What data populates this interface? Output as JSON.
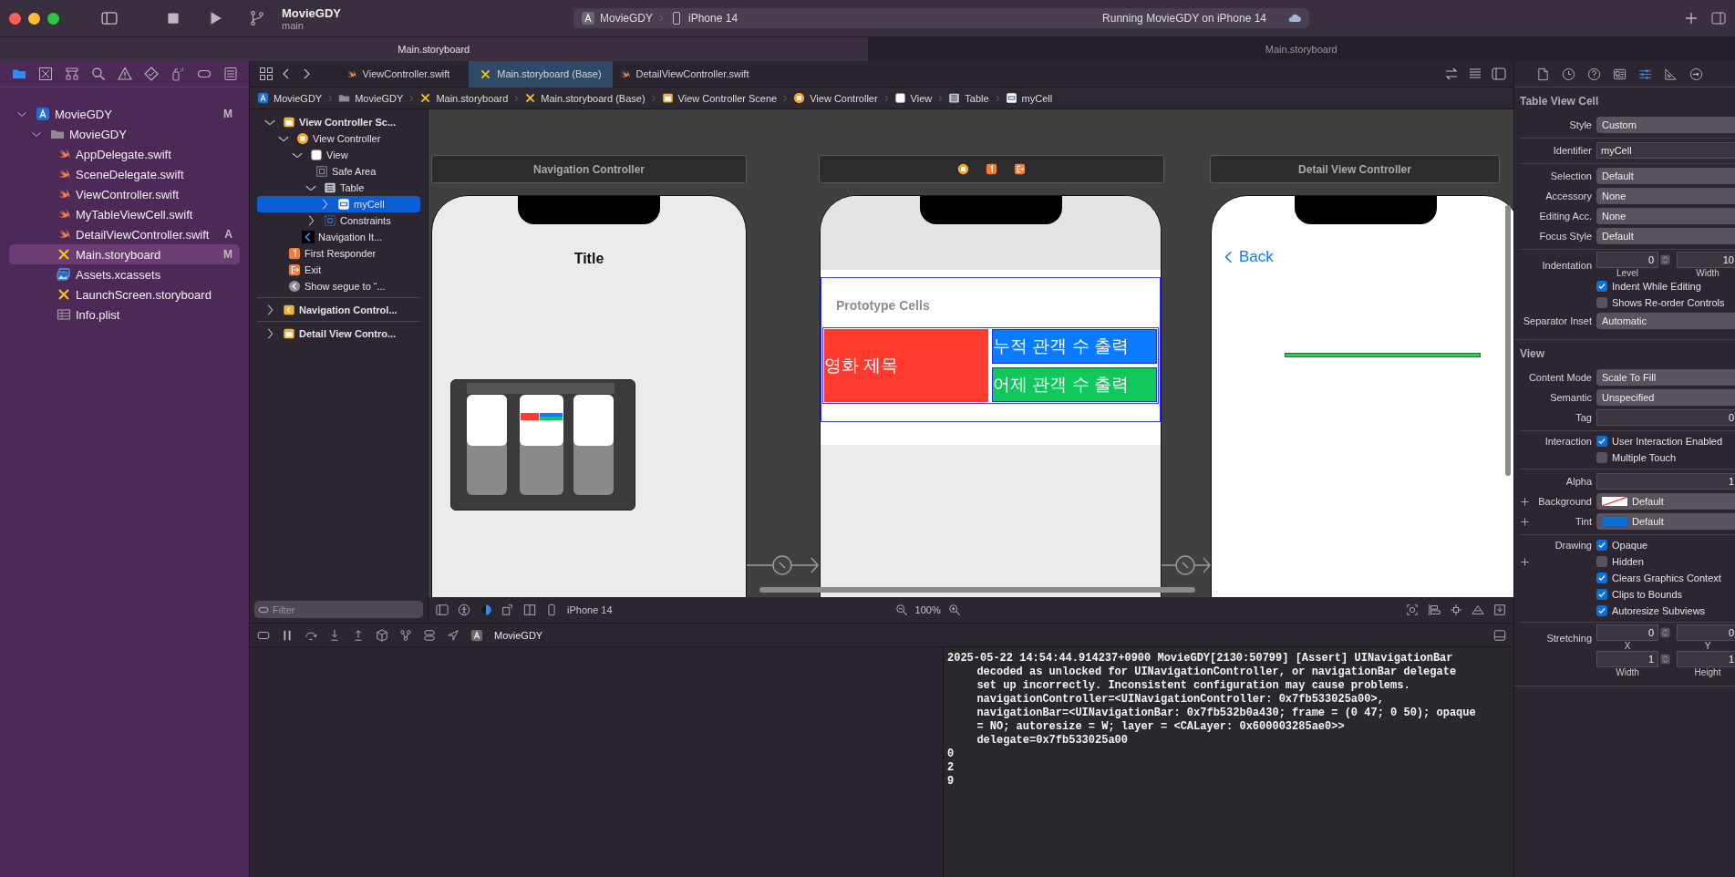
{
  "window": {
    "project": "MovieGDY",
    "branch": "main",
    "run_app": "MovieGDY",
    "run_device": "iPhone 14",
    "status": "Running MovieGDY on iPhone 14"
  },
  "window_tabs": [
    {
      "label": "Main.storyboard",
      "selected": true
    },
    {
      "label": "Main.storyboard",
      "selected": false
    }
  ],
  "navigator": {
    "toolbar": [
      {
        "selected": true
      },
      {
        "selected": false
      },
      {
        "selected": false
      },
      {
        "selected": false
      },
      {
        "selected": false
      },
      {
        "selected": false
      },
      {
        "selected": false
      },
      {
        "selected": false
      },
      {
        "selected": false
      }
    ],
    "items": [
      {
        "name": "MovieGDY",
        "kind": "project",
        "badge": "M",
        "expanded": true,
        "selected": false,
        "children": [
          {
            "name": "MovieGDY",
            "kind": "folder",
            "expanded": true,
            "selected": false,
            "children": [
              {
                "name": "AppDelegate.swift",
                "kind": "swift",
                "selected": false
              },
              {
                "name": "SceneDelegate.swift",
                "kind": "swift",
                "selected": false
              },
              {
                "name": "ViewController.swift",
                "kind": "swift",
                "selected": false
              },
              {
                "name": "MyTableViewCell.swift",
                "kind": "swift",
                "selected": false
              },
              {
                "name": "DetailViewController.swift",
                "kind": "swift",
                "badge": "A",
                "selected": false
              },
              {
                "name": "Main.storyboard",
                "kind": "storyboard",
                "badge": "M",
                "selected": true
              },
              {
                "name": "Assets.xcassets",
                "kind": "assets",
                "selected": false
              },
              {
                "name": "LaunchScreen.storyboard",
                "kind": "storyboard",
                "selected": false
              },
              {
                "name": "Info.plist",
                "kind": "plist",
                "selected": false
              }
            ]
          }
        ]
      }
    ]
  },
  "editor_tabs": [
    {
      "label": "ViewController.swift",
      "kind": "swift",
      "selected": false
    },
    {
      "label": "Main.storyboard (Base)",
      "kind": "storyboard",
      "selected": true
    },
    {
      "label": "DetailViewController.swift",
      "kind": "swift",
      "selected": false
    }
  ],
  "breadcrumb": [
    {
      "label": "MovieGDY",
      "kind": "project"
    },
    {
      "label": "MovieGDY",
      "kind": "folder"
    },
    {
      "label": "Main.storyboard",
      "kind": "storyboard"
    },
    {
      "label": "Main.storyboard (Base)",
      "kind": "storyboard"
    },
    {
      "label": "View Controller Scene",
      "kind": "scene"
    },
    {
      "label": "View Controller",
      "kind": "vc"
    },
    {
      "label": "View",
      "kind": "view"
    },
    {
      "label": "Table",
      "kind": "table"
    },
    {
      "label": "myCell",
      "kind": "cell"
    }
  ],
  "outline": {
    "items": [
      {
        "name": "View Controller Sc...",
        "kind": "scene",
        "expanded": true,
        "selected": false,
        "children": [
          {
            "name": "View Controller",
            "kind": "vc",
            "expanded": true,
            "selected": false,
            "children": [
              {
                "name": "View",
                "kind": "view",
                "expanded": true,
                "selected": false,
                "children": [
                  {
                    "name": "Safe Area",
                    "kind": "safearea",
                    "selected": false
                  },
                  {
                    "name": "Table",
                    "kind": "table",
                    "expanded": true,
                    "selected": false,
                    "children": [
                      {
                        "name": "myCell",
                        "kind": "cell",
                        "expanded": false,
                        "selected": true
                      }
                    ]
                  },
                  {
                    "name": "Constraints",
                    "kind": "constraints",
                    "expanded": false,
                    "selected": false
                  }
                ]
              },
              {
                "name": "Navigation It...",
                "kind": "navitem",
                "selected": false
              }
            ]
          },
          {
            "name": "First Responder",
            "kind": "responder",
            "selected": false
          },
          {
            "name": "Exit",
            "kind": "exit",
            "selected": false
          },
          {
            "name": "Show segue to “...",
            "kind": "segue",
            "selected": false
          }
        ]
      },
      {
        "name": "Navigation Control...",
        "kind": "navscene",
        "expanded": false,
        "selected": false
      },
      {
        "name": "Detail View Contro...",
        "kind": "scene",
        "expanded": false,
        "selected": false
      }
    ],
    "filter_placeholder": "Filter"
  },
  "canvas": {
    "scenes": [
      {
        "kind": "navigation",
        "header": "Navigation Controller",
        "title": "Title"
      },
      {
        "kind": "table",
        "section_header": "Prototype Cells",
        "labels": [
          {
            "text": "영화 제목",
            "color": "#ff3b30"
          },
          {
            "text": "누적 관객 수 출력",
            "color": "#0a7aff"
          },
          {
            "text": "어제 관객 수 출력",
            "color": "#0fc75a"
          }
        ]
      },
      {
        "kind": "detail",
        "header": "Detail View Controller",
        "back": "Back"
      }
    ],
    "device": "iPhone 14",
    "zoom": "100%"
  },
  "debug_bar": {
    "scheme": "MovieGDY"
  },
  "console": {
    "entries": [
      {
        "lines": [
          "2025-05-22 14:54:44.914237+0900 MovieGDY[2130:50799] [Assert] UINavigationBar",
          "decoded as unlocked for UINavigationController, or navigationBar delegate",
          "set up incorrectly. Inconsistent configuration may cause problems.",
          "navigationController=<UINavigationController: 0x7fb533025a00>,",
          "navigationBar=<UINavigationBar: 0x7fb532b0a430; frame = (0 47; 0 50); opaque",
          "= NO; autoresize = W; layer = <CALayer: 0x600003285ae0>>",
          "delegate=0x7fb533025a00"
        ]
      },
      {
        "lines": [
          "0"
        ]
      },
      {
        "lines": [
          "2"
        ]
      },
      {
        "lines": [
          "9"
        ]
      }
    ]
  },
  "inspector": {
    "toolbar": [
      {
        "selected": false
      },
      {
        "selected": false
      },
      {
        "selected": false
      },
      {
        "selected": false
      },
      {
        "selected": true
      },
      {
        "selected": false
      },
      {
        "selected": false
      }
    ],
    "sections": [
      {
        "title": "Table View Cell",
        "groups": [
          [
            {
              "kind": "popup",
              "label": "Style",
              "value": "Custom"
            }
          ],
          [
            {
              "kind": "text",
              "label": "Identifier",
              "value": "myCell"
            }
          ],
          [
            {
              "kind": "popup",
              "label": "Selection",
              "value": "Default"
            },
            {
              "kind": "popup",
              "label": "Accessory",
              "value": "None"
            },
            {
              "kind": "popup",
              "label": "Editing Acc.",
              "value": "None"
            },
            {
              "kind": "popup",
              "label": "Focus Style",
              "value": "Default"
            }
          ],
          [
            {
              "kind": "pair",
              "label": "Indentation",
              "values": [
                "0",
                "10"
              ],
              "captions": [
                "Level",
                "Width"
              ]
            },
            {
              "kind": "check",
              "text": "Indent While Editing",
              "checked": true
            },
            {
              "kind": "check",
              "text": "Shows Re-order Controls",
              "checked": false
            },
            {
              "kind": "popup",
              "label": "Separator Inset",
              "value": "Automatic"
            }
          ]
        ]
      },
      {
        "title": "View",
        "groups": [
          [
            {
              "kind": "popup",
              "label": "Content Mode",
              "value": "Scale To Fill"
            },
            {
              "kind": "popup",
              "label": "Semantic",
              "value": "Unspecified"
            },
            {
              "kind": "number",
              "label": "Tag",
              "value": "0"
            }
          ],
          [
            {
              "kind": "check",
              "label": "Interaction",
              "text": "User Interaction Enabled",
              "checked": true
            },
            {
              "kind": "check",
              "text": "Multiple Touch",
              "checked": false
            }
          ],
          [
            {
              "kind": "number",
              "label": "Alpha",
              "value": "1"
            },
            {
              "kind": "color",
              "label": "Background",
              "value": "Default",
              "plus": true
            },
            {
              "kind": "color",
              "label": "Tint",
              "value": "Default",
              "color": "#0a6fd6",
              "plus": true
            }
          ],
          [
            {
              "kind": "check",
              "label": "Drawing",
              "text": "Opaque",
              "checked": true
            },
            {
              "kind": "check",
              "text": "Hidden",
              "checked": false,
              "plus": true
            },
            {
              "kind": "check",
              "text": "Clears Graphics Context",
              "checked": true
            },
            {
              "kind": "check",
              "text": "Clips to Bounds",
              "checked": true
            },
            {
              "kind": "check",
              "text": "Autoresize Subviews",
              "checked": true
            }
          ],
          [
            {
              "kind": "pair",
              "label": "Stretching",
              "values": [
                "0",
                "0"
              ],
              "captions": [
                "X",
                "Y"
              ]
            },
            {
              "kind": "pair",
              "values": [
                "1",
                "1"
              ],
              "captions": [
                "Width",
                "Height"
              ]
            }
          ]
        ]
      }
    ]
  }
}
